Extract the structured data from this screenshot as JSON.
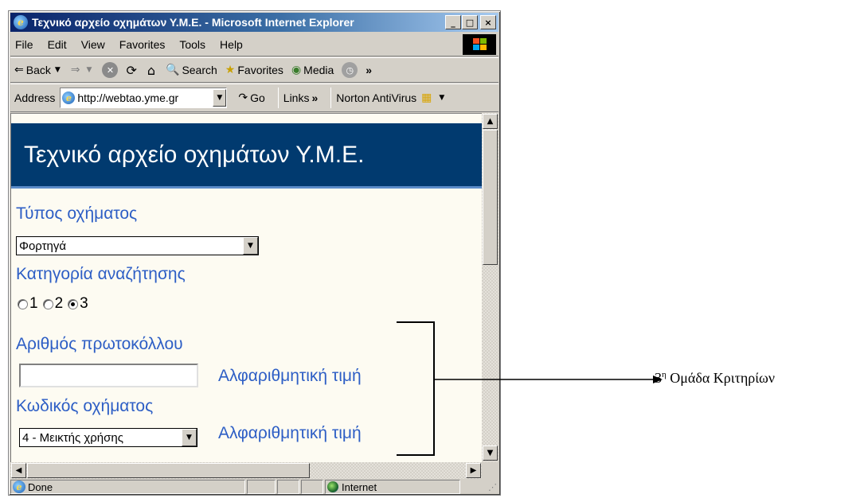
{
  "window": {
    "title": "Τεχνικό αρχείο οχημάτων Υ.Μ.Ε. - Microsoft Internet Explorer",
    "minimize": "_",
    "maximize": "□",
    "close": "×"
  },
  "menubar": {
    "items": [
      "File",
      "Edit",
      "View",
      "Favorites",
      "Tools",
      "Help"
    ]
  },
  "toolbar": {
    "back": "Back",
    "search": "Search",
    "favorites": "Favorites",
    "media": "Media",
    "overflow": "»"
  },
  "addressbar": {
    "label": "Address",
    "url": "http://webtao.yme.gr",
    "go": "Go",
    "links": "Links",
    "links_overflow": "»",
    "norton": "Norton AntiVirus"
  },
  "page": {
    "banner_title": "Τεχνικό αρχείο οχημάτων Υ.Μ.Ε.",
    "vehicle_type_label": "Τύπος οχήματος",
    "vehicle_type_value": "Φορτηγά",
    "search_category_label": "Κατηγορία αναζήτησης",
    "radios": [
      {
        "label": "1",
        "checked": false
      },
      {
        "label": "2",
        "checked": false
      },
      {
        "label": "3",
        "checked": true
      }
    ],
    "protocol_label": "Αριθμός πρωτοκόλλου",
    "protocol_value": "",
    "protocol_hint": "Αλφαριθμητική τιμή",
    "vehicle_code_label": "Κωδικός οχήματος",
    "vehicle_code_value": "4 - Μεικτής χρήσης",
    "vehicle_code_hint": "Αλφαριθμητική τιμή"
  },
  "statusbar": {
    "status": "Done",
    "zone": "Internet"
  },
  "annotation": {
    "number": "3",
    "superscript": "η",
    "text": " Ομάδα Κριτηρίων"
  },
  "colors": {
    "banner_bg": "#013a6f",
    "label_blue": "#2d5ec5",
    "page_bg": "#fdfbf2",
    "chrome": "#d4d0c8"
  }
}
